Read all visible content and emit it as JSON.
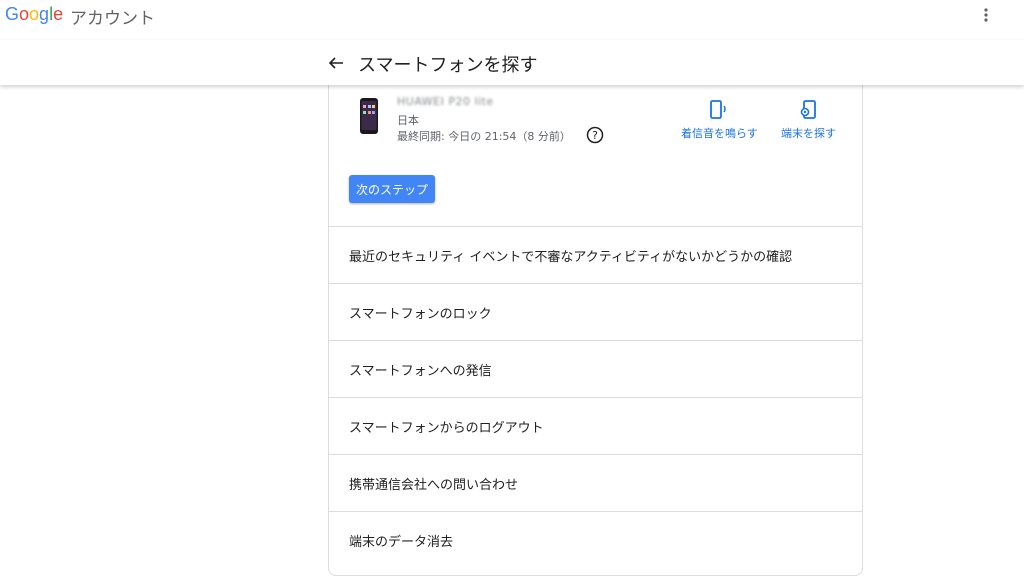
{
  "brand": {
    "logo": "Google",
    "title": "アカウント"
  },
  "header": {
    "title": "スマートフォンを探す"
  },
  "device": {
    "name": "HUAWEI P20 lite",
    "country": "日本",
    "last_sync": "最終同期: 今日の 21:54（8 分前）"
  },
  "actions": [
    {
      "label": "着信音を鳴らす",
      "icon": "phone-ring-icon"
    },
    {
      "label": "端末を探す",
      "icon": "phone-locate-icon"
    }
  ],
  "next_button": "次のステップ",
  "list": [
    "最近のセキュリティ イベントで不審なアクティビティがないかどうかの確認",
    "スマートフォンのロック",
    "スマートフォンへの発信",
    "スマートフォンからのログアウト",
    "携帯通信会社への問い合わせ",
    "端末のデータ消去"
  ],
  "colors": {
    "accent": "#1a73e8",
    "button": "#4285f4"
  }
}
